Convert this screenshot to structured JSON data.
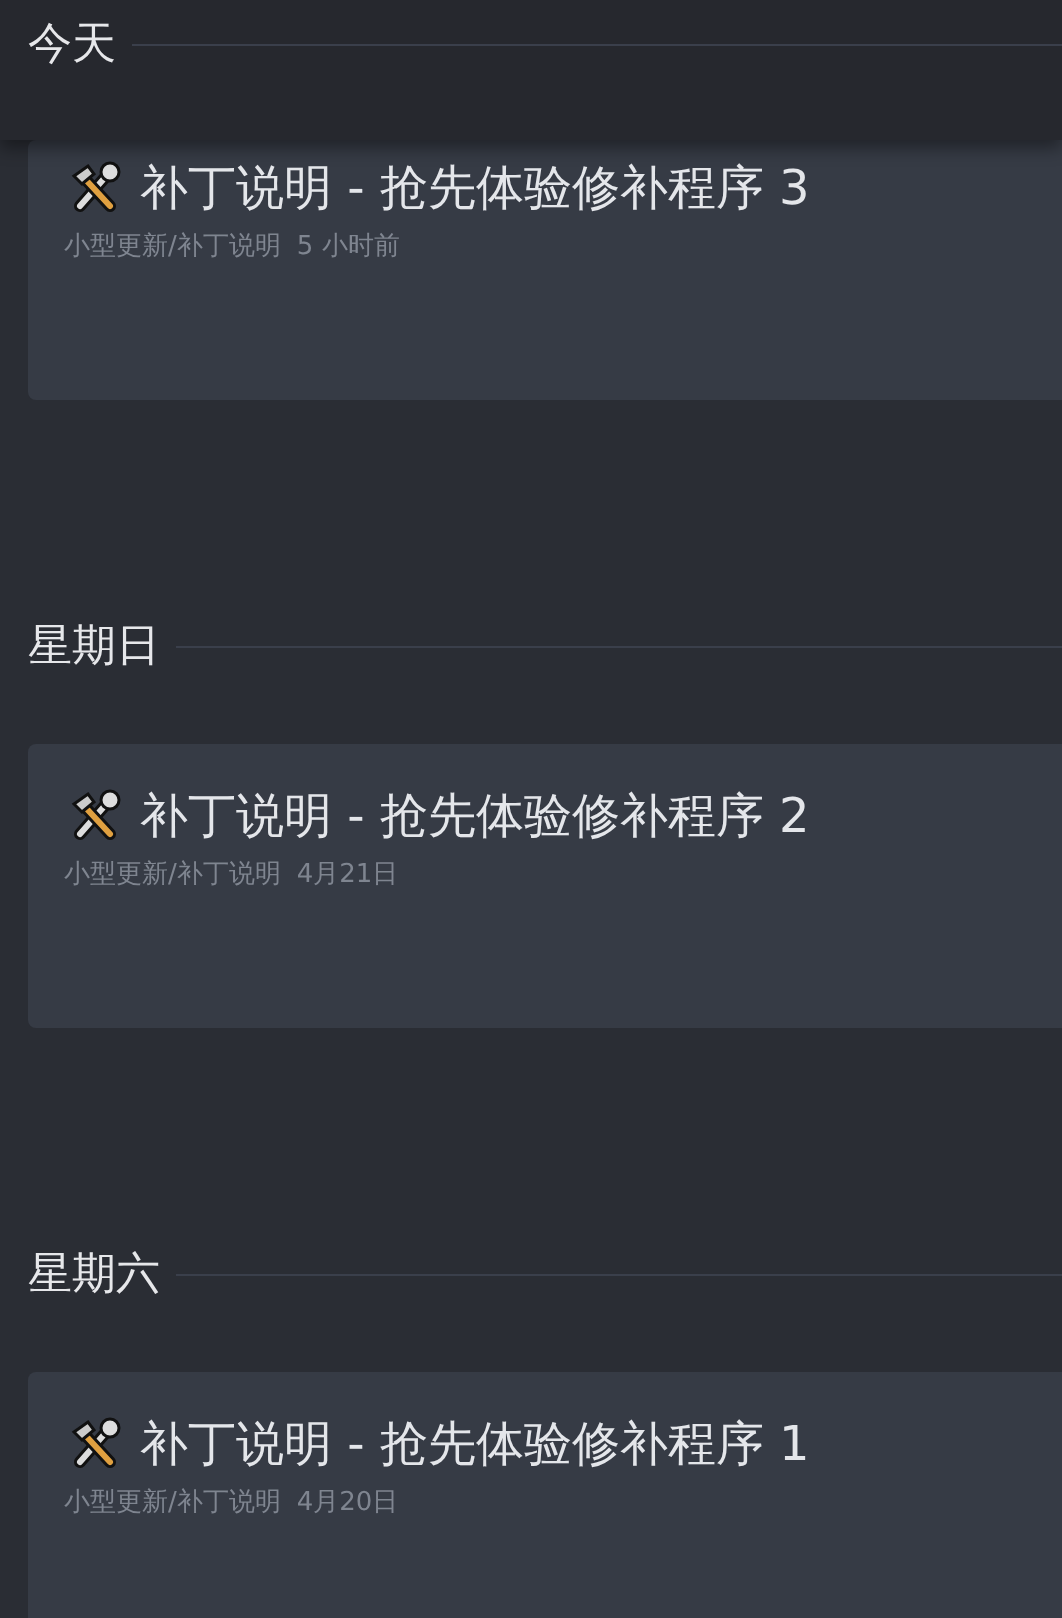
{
  "sections": [
    {
      "heading": "今天",
      "sticky": true,
      "posts": [
        {
          "title": "补丁说明 - 抢先体验修补程序 3",
          "category": "小型更新/补丁说明",
          "time": "5 小时前"
        }
      ]
    },
    {
      "heading": "星期日",
      "sticky": false,
      "posts": [
        {
          "title": "补丁说明 - 抢先体验修补程序 2",
          "category": "小型更新/补丁说明",
          "time": "4月21日"
        }
      ]
    },
    {
      "heading": "星期六",
      "sticky": false,
      "posts": [
        {
          "title": "补丁说明 - 抢先体验修补程序 1",
          "category": "小型更新/补丁说明",
          "time": "4月20日"
        }
      ]
    }
  ]
}
